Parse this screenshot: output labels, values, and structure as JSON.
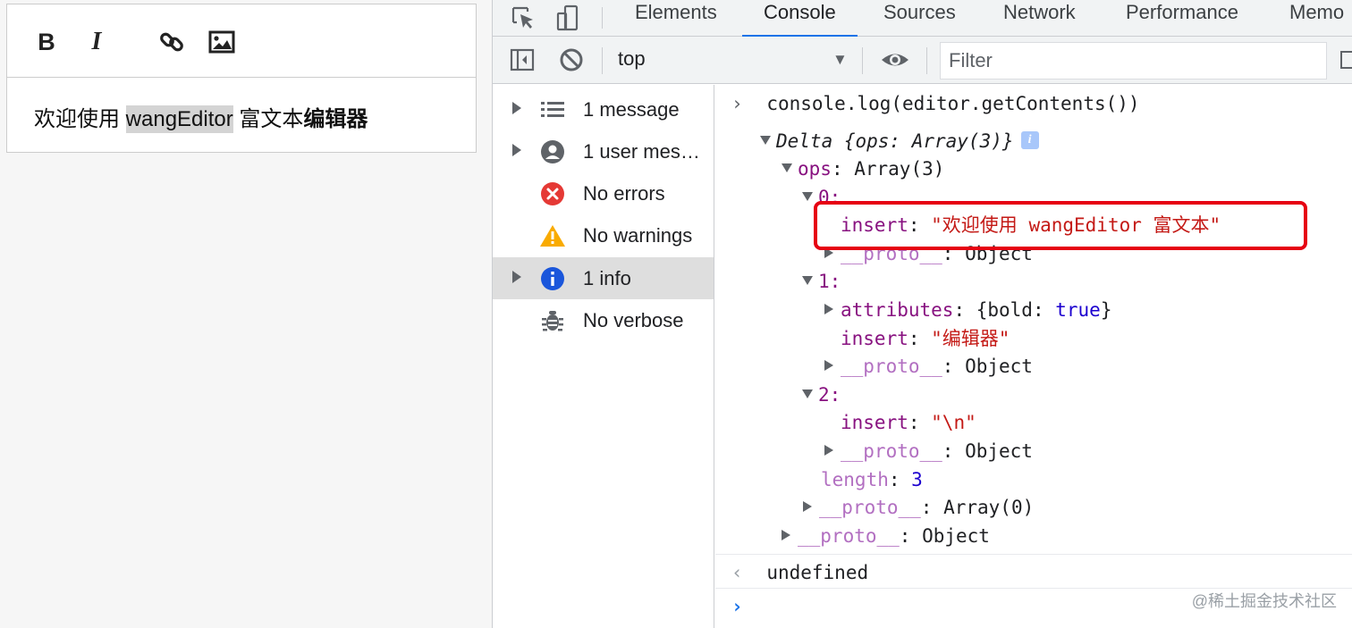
{
  "editor": {
    "toolbar": {
      "bold_label": "B",
      "italic_label": "I"
    },
    "content": {
      "plain_text": "欢迎使用 ",
      "selected_text": "wangEditor",
      "middle_text": " 富文本",
      "bold_text": "编辑器"
    }
  },
  "devtools": {
    "tabs": [
      "Elements",
      "Console",
      "Sources",
      "Network",
      "Performance",
      "Memo"
    ],
    "active_tab": "Console",
    "toolbar": {
      "context": "top",
      "filter_placeholder": "Filter"
    },
    "sidebar": {
      "items": [
        {
          "label": "1 message",
          "icon": "list-icon",
          "expandable": true
        },
        {
          "label": "1 user mes…",
          "icon": "user-icon",
          "expandable": true
        },
        {
          "label": "No errors",
          "icon": "error-icon",
          "expandable": false
        },
        {
          "label": "No warnings",
          "icon": "warning-icon",
          "expandable": false
        },
        {
          "label": "1 info",
          "icon": "info-icon",
          "expandable": true,
          "selected": true
        },
        {
          "label": "No verbose",
          "icon": "bug-icon",
          "expandable": false
        }
      ]
    },
    "console": {
      "command": "console.log(editor.getContents())",
      "delta_head": "Delta {ops: Array(3)}",
      "info_badge": "i",
      "ops_key": "ops",
      "ops_value": "Array(3)",
      "items": [
        {
          "index": "0:",
          "insert": "\"欢迎使用 wangEditor 富文本\"",
          "proto": "Object"
        },
        {
          "index": "1:",
          "attributes": "{bold: true}",
          "insert": "\"编辑器\"",
          "proto": "Object"
        },
        {
          "index": "2:",
          "insert": "\"\\n\"",
          "proto": "Object"
        }
      ],
      "insert_key": "insert",
      "attributes_key": "attributes",
      "attr_open": "{bold: ",
      "attr_value": "true",
      "attr_close": "}",
      "proto_key": "__proto__",
      "length_key": "length",
      "length_value": "3",
      "array_proto": "Array(0)",
      "object_proto": "Object",
      "result": "undefined"
    },
    "watermark": "@稀土掘金技术社区"
  }
}
